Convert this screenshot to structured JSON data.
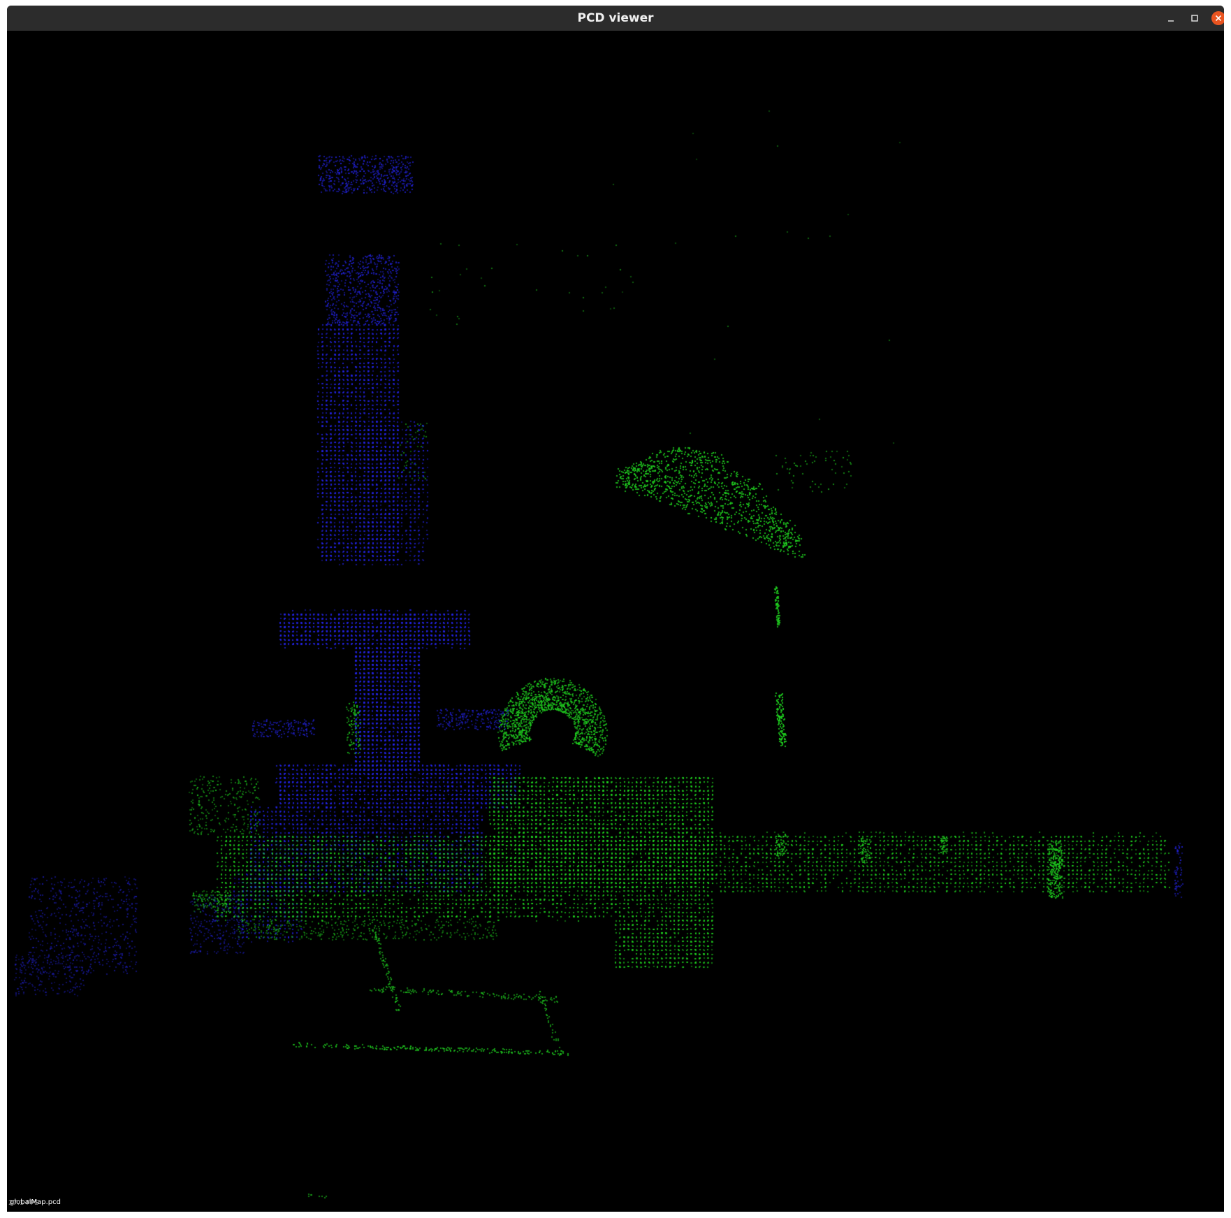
{
  "window": {
    "title": "PCD viewer",
    "controls": {
      "minimize_icon": "minimize-icon",
      "maximize_icon": "maximize-icon",
      "close_icon": "close-icon",
      "close_color": "#e95420"
    }
  },
  "viewer": {
    "background": "#000000",
    "fps_text": "27.1 FPS",
    "file_name": "globalMap.pcd",
    "point_colors": {
      "near": "#1fd21f",
      "far": "#2323e6"
    }
  }
}
